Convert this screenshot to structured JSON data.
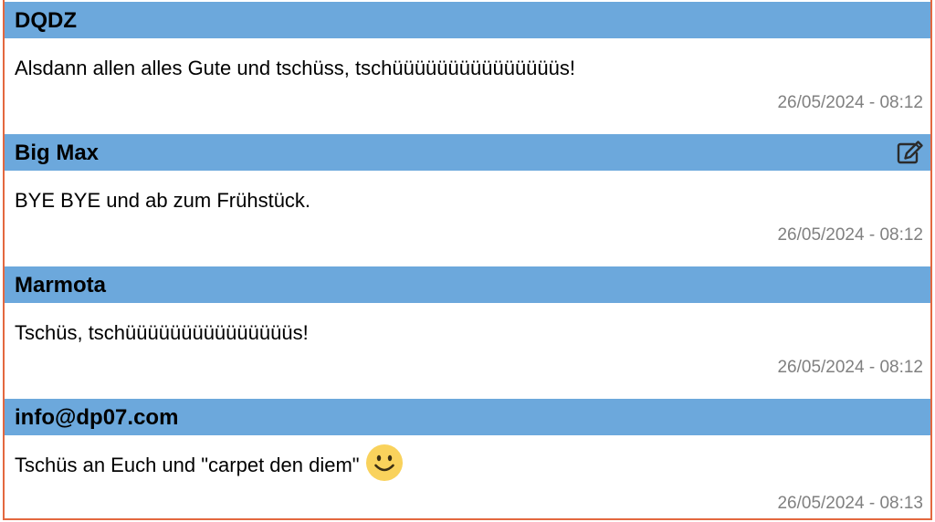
{
  "posts": [
    {
      "author": "DQDZ",
      "text": "Alsdann allen alles Gute und tschüss, tschüüüüüüüüüüüüüüüs!",
      "timestamp": "26/05/2024 - 08:12"
    },
    {
      "author": "Big Max",
      "text": "BYE BYE und ab zum Frühstück.",
      "timestamp": "26/05/2024 - 08:12",
      "edit_icon": "edit-icon"
    },
    {
      "author": "Marmota",
      "text": "Tschüs, tschüüüüüüüüüüüüüüüs!",
      "timestamp": "26/05/2024 - 08:12"
    },
    {
      "author": "info@dp07.com",
      "text": "Tschüs an Euch und \"carpet den diem\"",
      "timestamp": "26/05/2024 - 08:13",
      "emoji": "smile-emoji-icon"
    }
  ],
  "colors": {
    "header_bg": "#6ca8dc",
    "frame_border": "#e3683f",
    "timestamp": "#808080",
    "emoji": "#f9d25c"
  }
}
